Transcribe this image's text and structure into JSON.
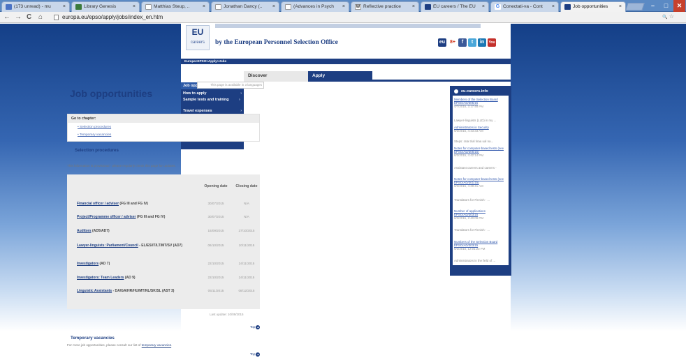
{
  "browser": {
    "tabs": [
      {
        "label": "(173 unread) - mu",
        "icon_color": "#4a73c5",
        "active": false
      },
      {
        "label": "Library Genesis",
        "icon_color": "#3b7a3b",
        "active": false
      },
      {
        "label": "Matthias Steup, ..",
        "icon_color": "#ffffff",
        "active": false
      },
      {
        "label": "Jonathan Dancy (..",
        "icon_color": "#ffffff",
        "active": false
      },
      {
        "label": "(Advances in Psych",
        "icon_color": "#ffffff",
        "active": false
      },
      {
        "label": "Reflective practice",
        "icon_color": "#ffffff",
        "active": false
      },
      {
        "label": "EU careers / The EU",
        "icon_color": "#1d3e82",
        "active": false
      },
      {
        "label": "Conectati-va - Cont",
        "icon_color": "#ffffff",
        "active": false
      },
      {
        "label": "Job opportunities",
        "icon_color": "#1d3e82",
        "active": true
      }
    ],
    "tab_close": "×",
    "url_text": "europa.eu/epso/apply/jobs/index_en.htm",
    "back_icon": "←",
    "forward_icon": "→",
    "reload_icon": "C",
    "home_icon": "⌂",
    "zoom_icon": "🔍",
    "star_icon": "☆",
    "win_min": "–",
    "win_max": "□",
    "win_close": "✕"
  },
  "site": {
    "logo_text": "EU",
    "logo_sub": "careers",
    "tagline": "by the European Personnel Selection Office",
    "social": [
      {
        "name": "eu",
        "label": "eu",
        "color": "#1d3e82"
      },
      {
        "name": "google-plus",
        "label": "8+",
        "color": "#d1361c"
      },
      {
        "name": "facebook",
        "label": "f",
        "color": "#3b5998"
      },
      {
        "name": "twitter",
        "label": "t",
        "color": "#4aa7d9"
      },
      {
        "name": "linkedin",
        "label": "in",
        "color": "#1b78b4"
      },
      {
        "name": "youtube",
        "label": "You",
        "color": "#c4302b"
      }
    ],
    "breadcrumb": "Europa>EPSO>Apply>Jobs",
    "nav_tabs": [
      {
        "label": "Discover",
        "active": false
      },
      {
        "label": "Apply",
        "active": true
      }
    ],
    "left_menu": [
      {
        "label": "Job opportunities",
        "arrow": ""
      },
      {
        "label": "How to apply",
        "arrow": "›"
      },
      {
        "label": "Sample tests and training",
        "arrow": "›"
      },
      {
        "label": "Travel expenses",
        "arrow": "›"
      }
    ],
    "availability": "This page is available in 3 languages",
    "page_title": "Job opportunities",
    "chapter": {
      "heading": "Go to chapter:",
      "links": [
        "Selection procedures",
        "Temporary vacancies"
      ]
    },
    "selection_heading": "Selection procedures",
    "info_note": "This information is provisional - please regularly check this page for updates.",
    "table_headers": {
      "opening": "Opening date",
      "closing": "Closing date"
    },
    "jobs": [
      {
        "link": "Financial officer / adviser",
        "suffix": " (FG III and FG IV)",
        "opening": "30/07/2015",
        "closing": "N/A"
      },
      {
        "link": "Project/Programme officer / adviser",
        "suffix": " (FG III and FG IV)",
        "opening": "30/07/2015",
        "closing": "N/A"
      },
      {
        "link": "Auditors",
        "suffix": " (AD5/AD7)",
        "opening": "15/09/2015",
        "closing": "27/10/2015"
      },
      {
        "link": "Lawyer-linguists: Parliament/Council",
        "suffix": " - EL/ES/IT/LT/MT/SV (AD7)",
        "opening": "06/10/2015",
        "closing": "10/11/2015"
      },
      {
        "link": "Investigators",
        "suffix": " (AD 7)",
        "opening": "22/10/2015",
        "closing": "24/11/2015"
      },
      {
        "link": "Investigators: Team Leaders",
        "suffix": " (AD 9)",
        "opening": "22/10/2015",
        "closing": "24/11/2015"
      },
      {
        "link": "Linguistic Assistants",
        "suffix": " - DA/GA/HR/HU/MT/NL/SK/SL (AST 3)",
        "opening": "05/11/2015",
        "closing": "08/12/2015"
      }
    ],
    "last_update": "Last update: 10/09/2015",
    "top_label": "Top",
    "temp_heading": "Temporary vacancies",
    "temp_note_pre": "For more job opportunities, please consult our list of ",
    "temp_note_link": "temporary vacancies",
    "temp_note_post": ".",
    "right_col": {
      "heading": "eu-careers.info",
      "items": [
        {
          "pre": "",
          "link": "Members of the Selection Board EPSO/AD/305/15",
          "time": "4/7/2015, 3:17:48 PM"
        },
        {
          "pre": "Lawyer-linguists (LLD) in my ...",
          "link": "",
          "time": ""
        },
        {
          "pre": "",
          "link": "Administrators in Security",
          "time": "6/3/2015, 4:43:33 AM"
        },
        {
          "pre": "Steps: rata trial tiraa ual na...",
          "link": "",
          "time": ""
        },
        {
          "pre": "",
          "link": "Notes for computer-based tests (see EPSO/AD/305/15)",
          "time": "6/3/2015, 4:42:14 PM"
        },
        {
          "pre": "Assistant careers and careers -",
          "link": "",
          "time": ""
        },
        {
          "pre": "",
          "link": "Notes for computer-based tests (see EPSO/AD/301/15)",
          "time": "6/3/2015, 4:38:41 AM"
        },
        {
          "pre": "Translators for Finnish - ...",
          "link": "",
          "time": ""
        },
        {
          "pre": "",
          "link": "Number of applications EPSO/AD/303/15",
          "time": "6/3/2015, 2:40:09 PM"
        },
        {
          "pre": "Translators for Finnish - ...",
          "link": "",
          "time": ""
        },
        {
          "pre": "",
          "link": "Numbers of the Selection Board EPSO/AD/303/15",
          "time": "6/3/2015, 12:01:23 PM"
        },
        {
          "pre": "Administrators in the field of ...",
          "link": "",
          "time": ""
        }
      ]
    }
  }
}
